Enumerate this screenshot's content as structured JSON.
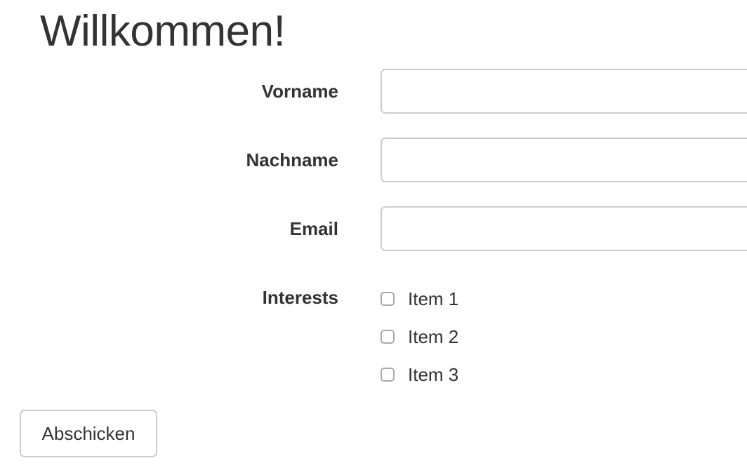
{
  "page": {
    "title": "Willkommen!"
  },
  "form": {
    "fields": [
      {
        "label": "Vorname",
        "value": "",
        "placeholder": ""
      },
      {
        "label": "Nachname",
        "value": "",
        "placeholder": ""
      },
      {
        "label": "Email",
        "value": "",
        "placeholder": ""
      }
    ],
    "interests": {
      "label": "Interests",
      "options": [
        {
          "label": "Item 1",
          "checked": false
        },
        {
          "label": "Item 2",
          "checked": false
        },
        {
          "label": "Item 3",
          "checked": false
        }
      ]
    },
    "submit_label": "Abschicken"
  },
  "colors": {
    "text": "#333333",
    "border": "#cccccc",
    "background": "#ffffff"
  }
}
